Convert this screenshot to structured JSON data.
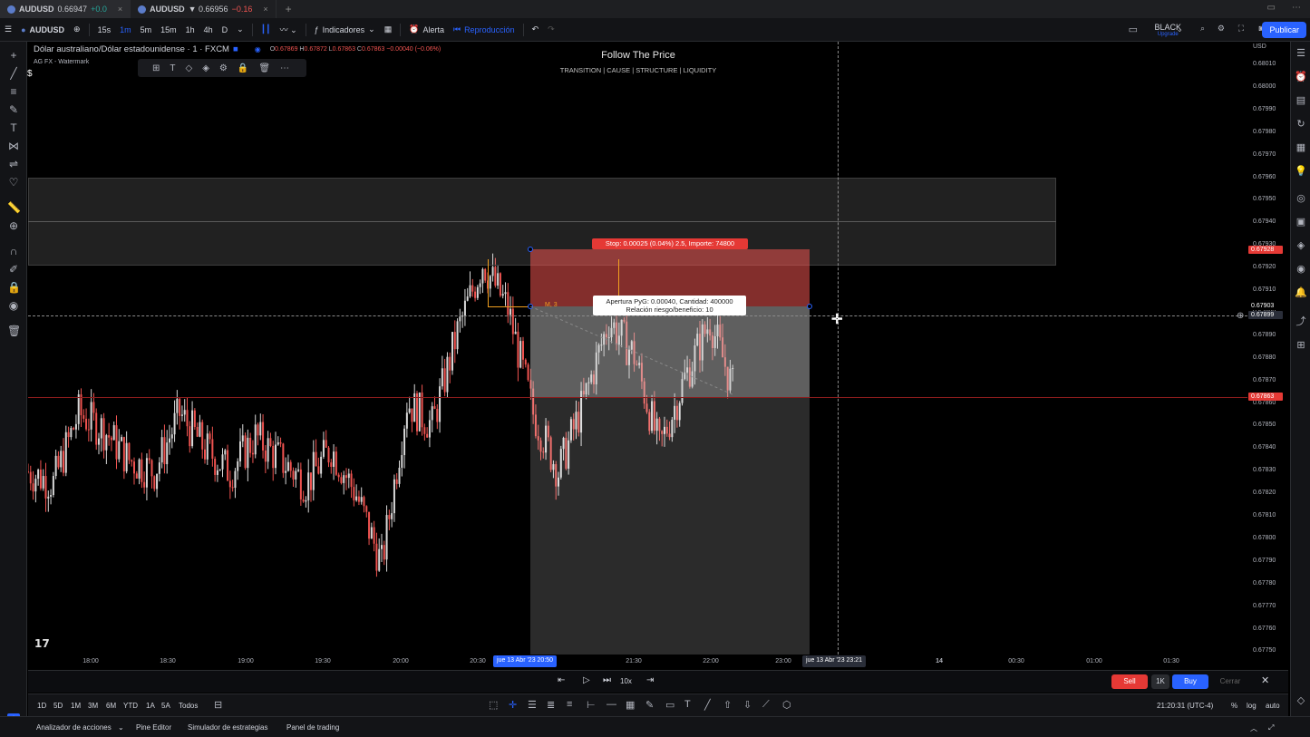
{
  "tabs": [
    {
      "symbol": "AUDUSD",
      "price": "0.66947",
      "change": "+0.0"
    },
    {
      "symbol": "AUDUSD",
      "price": "▼ 0.66956",
      "change": "−0.16"
    }
  ],
  "toolbar": {
    "symbol": "AUDUSD",
    "intervals": [
      "15s",
      "1m",
      "5m",
      "15m",
      "1h",
      "4h",
      "D"
    ],
    "active_interval": "1m",
    "indicators_label": "Indicadores",
    "alert_label": "Alerta",
    "replay_label": "Reproducción",
    "account_name": "BLACK",
    "account_sub": "Upgrade",
    "publish_label": "Publicar"
  },
  "legend": {
    "title": "Dólar australiano/Dólar estadounidense · 1 · FXCM",
    "o_label": "O",
    "o": "0.67869",
    "h_label": "H",
    "h": "0.67872",
    "l_label": "L",
    "l": "0.67863",
    "c_label": "C",
    "c": "0.67863",
    "change": "−0.00040 (−0.06%)",
    "watermark": "AG FX - Watermark"
  },
  "overlay": {
    "title": "Follow The Price",
    "subtitle": "TRANSITION | CAUSE | STRUCTURE | LIQUIDITY"
  },
  "position_tool": {
    "stop_label": "Stop: 0.00025 (0.04%) 2.5, Importe: 74800",
    "info_line1": "Apertura PyG: 0.00040, Cantidad: 400000",
    "info_line2": "Relación riesgo/beneficio: 10",
    "marker": "M, 3"
  },
  "price_axis": {
    "currency": "USD",
    "ticks": [
      "0.68010",
      "0.68000",
      "0.67990",
      "0.67980",
      "0.67970",
      "0.67960",
      "0.67950",
      "0.67940",
      "0.67930",
      "0.67920",
      "0.67910",
      "0.67900",
      "0.67890",
      "0.67880",
      "0.67870",
      "0.67860",
      "0.67850",
      "0.67840",
      "0.67830",
      "0.67820",
      "0.67810",
      "0.67800",
      "0.67790",
      "0.67780",
      "0.67770",
      "0.67760",
      "0.67750"
    ],
    "label_red_top": "0.67928",
    "label_white": "0.67903",
    "label_cross": "0.67899",
    "label_red_bottom": "0.67863"
  },
  "time_axis": {
    "ticks": [
      "18:00",
      "18:30",
      "19:00",
      "19:30",
      "20:00",
      "20:30",
      "21:30",
      "22:00",
      "23:00",
      "14",
      "00:30",
      "01:00",
      "01:30"
    ],
    "hl_start": "jue 13 Abr '23  20:50",
    "hl_cross": "jue 13 Abr '23  23:21"
  },
  "replay": {
    "speed": "10x",
    "sell": "Sell",
    "qty": "1K",
    "buy": "Buy",
    "close": "Cerrar"
  },
  "bottom": {
    "ranges": [
      "1D",
      "5D",
      "1M",
      "3M",
      "6M",
      "YTD",
      "1A",
      "5A",
      "Todos"
    ],
    "clock": "21:20:31 (UTC-4)",
    "pct": "%",
    "log": "log",
    "auto": "auto"
  },
  "panels": [
    "Analizador de acciones",
    "Pine Editor",
    "Simulador de estrategias",
    "Panel de trading"
  ],
  "chart_data": {
    "type": "line",
    "x": [
      "17:40",
      "17:50",
      "18:00",
      "18:10",
      "18:20",
      "18:30",
      "18:40",
      "18:50",
      "19:00",
      "19:10",
      "19:20",
      "19:30",
      "19:40",
      "19:50",
      "20:00",
      "20:10",
      "20:20",
      "20:30",
      "20:40",
      "20:50",
      "21:00",
      "21:10",
      "21:20",
      "21:30",
      "21:40",
      "21:50",
      "22:00",
      "22:10",
      "22:20"
    ],
    "series": [
      {
        "values": [
          0.6783,
          0.67825,
          0.67855,
          0.67848,
          0.67835,
          0.6783,
          0.67855,
          0.6784,
          0.6783,
          0.67845,
          0.67835,
          0.67825,
          0.6784,
          0.6782,
          0.6779,
          0.6786,
          0.6785,
          0.6789,
          0.6792,
          0.679,
          0.67855,
          0.6783,
          0.6786,
          0.67895,
          0.6788,
          0.6784,
          0.6787,
          0.67895,
          0.67863
        ]
      }
    ],
    "ylim": [
      0.67745,
      0.68015
    ],
    "colors": {
      "up": "#d8d8d8",
      "down": "#ef5350"
    }
  }
}
